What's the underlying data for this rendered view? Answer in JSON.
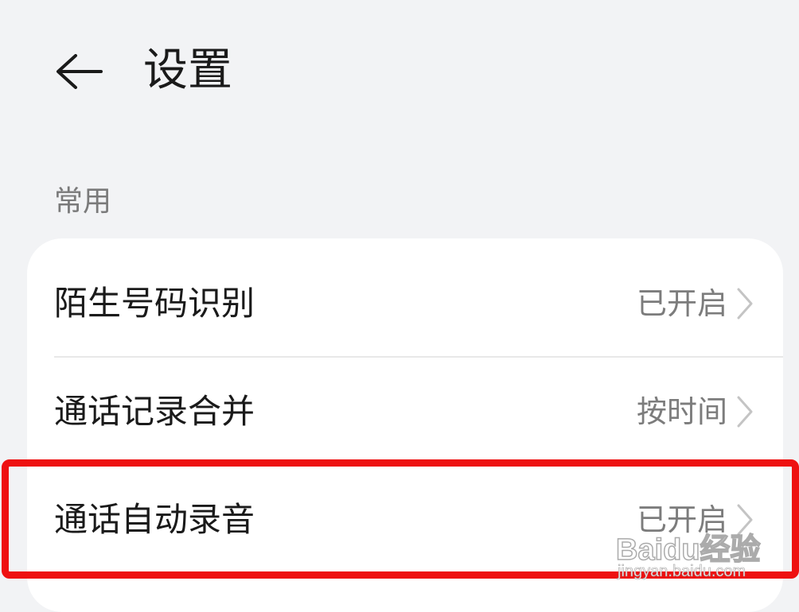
{
  "header": {
    "title": "设置",
    "back_icon": "arrow-left-icon"
  },
  "section": {
    "label": "常用"
  },
  "settings": [
    {
      "label": "陌生号码识别",
      "value": "已开启"
    },
    {
      "label": "通话记录合并",
      "value": "按时间"
    },
    {
      "label": "通话自动录音",
      "value": "已开启"
    }
  ],
  "icons": {
    "chevron": "chevron-right-icon"
  },
  "watermark": {
    "brand": "Baidu经验",
    "url": "jingyan.baidu.com"
  },
  "colors": {
    "background": "#f2f3f5",
    "card": "#ffffff",
    "highlight": "#ee1111",
    "value_text": "#7c7c7c"
  }
}
